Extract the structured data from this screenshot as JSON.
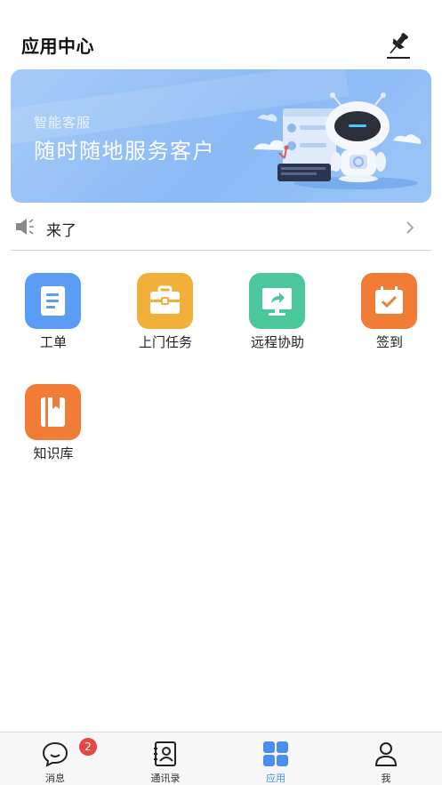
{
  "header": {
    "title": "应用中心",
    "pin_icon": "pin-icon"
  },
  "banner": {
    "subtitle": "智能客服",
    "title": "随时随地服务客户"
  },
  "notice": {
    "text": "来了",
    "icon": "speaker-icon"
  },
  "apps": [
    {
      "label": "工单",
      "icon": "document-icon",
      "color": "#5b9cf4"
    },
    {
      "label": "上门任务",
      "icon": "briefcase-icon",
      "color": "#f0b03a"
    },
    {
      "label": "远程协助",
      "icon": "screen-share-icon",
      "color": "#4cc79b"
    },
    {
      "label": "签到",
      "icon": "calendar-check-icon",
      "color": "#f07c35"
    },
    {
      "label": "知识库",
      "icon": "book-icon",
      "color": "#f07c35"
    }
  ],
  "tabbar": {
    "tabs": [
      {
        "label": "消息",
        "icon": "chat-icon",
        "badge": "2"
      },
      {
        "label": "通讯录",
        "icon": "contacts-icon"
      },
      {
        "label": "应用",
        "icon": "apps-grid-icon",
        "active": true
      },
      {
        "label": "我",
        "icon": "user-icon"
      }
    ]
  },
  "colors": {
    "accent": "#4a8ff0",
    "badge": "#e84545",
    "banner": "#8ab9f5"
  }
}
